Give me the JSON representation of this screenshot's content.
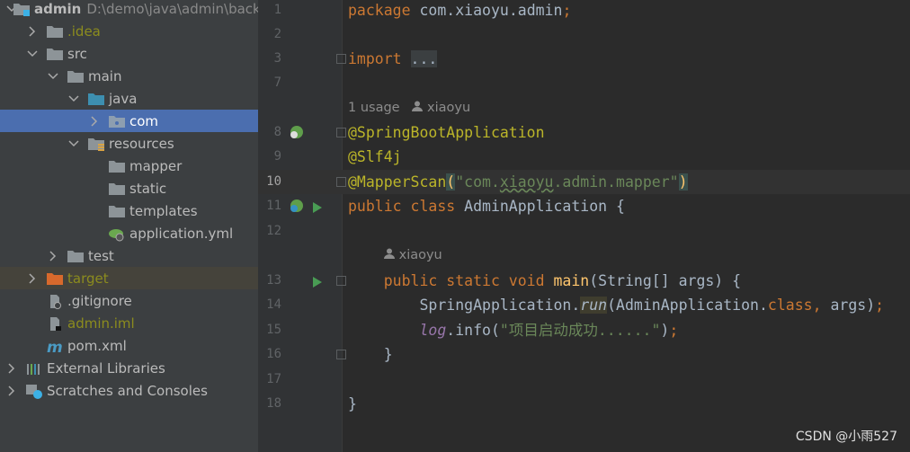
{
  "project_tree": [
    {
      "label": "admin",
      "extra": "D:\\demo\\java\\admin\\back",
      "depth": 0,
      "expanded": true,
      "icon": "module-folder-icon",
      "bold": true
    },
    {
      "label": ".idea",
      "depth": 1,
      "expanded": false,
      "icon": "folder-icon",
      "color": "olive"
    },
    {
      "label": "src",
      "depth": 1,
      "expanded": true,
      "icon": "folder-icon"
    },
    {
      "label": "main",
      "depth": 2,
      "expanded": true,
      "icon": "folder-icon"
    },
    {
      "label": "java",
      "depth": 3,
      "expanded": true,
      "icon": "source-folder-icon"
    },
    {
      "label": "com",
      "depth": 4,
      "expanded": false,
      "icon": "package-icon",
      "selected": true
    },
    {
      "label": "resources",
      "depth": 3,
      "expanded": true,
      "icon": "resources-folder-icon"
    },
    {
      "label": "mapper",
      "depth": 4,
      "icon": "folder-icon"
    },
    {
      "label": "static",
      "depth": 4,
      "icon": "folder-icon"
    },
    {
      "label": "templates",
      "depth": 4,
      "icon": "folder-icon"
    },
    {
      "label": "application.yml",
      "depth": 4,
      "icon": "spring-config-icon"
    },
    {
      "label": "test",
      "depth": 2,
      "expanded": false,
      "icon": "folder-icon"
    },
    {
      "label": "target",
      "depth": 1,
      "expanded": false,
      "icon": "excluded-folder-icon",
      "color": "olive",
      "excluded": true
    },
    {
      "label": ".gitignore",
      "depth": 1,
      "icon": "gitignore-file-icon"
    },
    {
      "label": "admin.iml",
      "depth": 1,
      "icon": "iml-file-icon",
      "color": "olive"
    },
    {
      "label": "pom.xml",
      "depth": 1,
      "icon": "maven-icon"
    },
    {
      "label": "External Libraries",
      "depth": 0,
      "expanded": false,
      "icon": "libraries-icon"
    },
    {
      "label": "Scratches and Consoles",
      "depth": 0,
      "expanded": false,
      "icon": "scratches-icon"
    }
  ],
  "colors": {
    "keyword": "#cc7832",
    "annotation": "#bbb529",
    "string": "#6a8759",
    "plain": "#a9b7c6",
    "method": "#ffc66d",
    "field": "#9876aa",
    "selection": "#4b6eaf"
  },
  "editor": {
    "current_line": "10",
    "lines": [
      {
        "n": "1",
        "tokens": [
          {
            "t": "package ",
            "c": "keyword"
          },
          {
            "t": "com.xiaoyu.admin",
            "c": "plain"
          },
          {
            "t": ";",
            "c": "keyword"
          }
        ]
      },
      {
        "n": "2",
        "tokens": []
      },
      {
        "n": "3",
        "fold": true,
        "tokens": [
          {
            "t": "import ",
            "c": "keyword"
          },
          {
            "t": "...",
            "c": "plain",
            "bg": "#3b3f41"
          }
        ]
      },
      {
        "n": "7",
        "tokens": []
      },
      {
        "hint": "1 usage",
        "author": "xiaoyu",
        "indent": 0
      },
      {
        "n": "8",
        "fold": true,
        "gutter": "spring-bean-icon",
        "tokens": [
          {
            "t": "@SpringBootApplication",
            "c": "annotation"
          }
        ]
      },
      {
        "n": "9",
        "tokens": [
          {
            "t": "@Slf4j",
            "c": "annotation"
          }
        ]
      },
      {
        "n": "10",
        "fold": true,
        "current": true,
        "tokens": [
          {
            "t": "@MapperScan",
            "c": "annotation"
          },
          {
            "t": "(",
            "c": "method",
            "bg": "#3b514d"
          },
          {
            "t": "\"com.",
            "c": "string"
          },
          {
            "t": "xiaoyu",
            "c": "string",
            "wavy": true
          },
          {
            "t": ".admin.mapper\"",
            "c": "string"
          },
          {
            "t": ")",
            "c": "method",
            "bg": "#3b514d"
          }
        ]
      },
      {
        "n": "11",
        "gutter": "spring-run-icon",
        "run": true,
        "tokens": [
          {
            "t": "public class ",
            "c": "keyword"
          },
          {
            "t": "AdminApplication {",
            "c": "plain"
          }
        ]
      },
      {
        "n": "12",
        "tokens": []
      },
      {
        "hint": "",
        "author": "xiaoyu",
        "indent": 4
      },
      {
        "n": "13",
        "run": true,
        "fold": true,
        "tokens": [
          {
            "t": "    public static void ",
            "c": "keyword"
          },
          {
            "t": "main",
            "c": "method"
          },
          {
            "t": "(String[] args) {",
            "c": "plain"
          }
        ]
      },
      {
        "n": "14",
        "tokens": [
          {
            "t": "        SpringApplication.",
            "c": "plain"
          },
          {
            "t": "run",
            "c": "plain",
            "italic": true,
            "bg": "#3f3d2e"
          },
          {
            "t": "(AdminApplication.",
            "c": "plain"
          },
          {
            "t": "class, ",
            "c": "keyword"
          },
          {
            "t": "args)",
            "c": "plain"
          },
          {
            "t": ";",
            "c": "keyword"
          }
        ]
      },
      {
        "n": "15",
        "tokens": [
          {
            "t": "        ",
            "c": "plain"
          },
          {
            "t": "log",
            "c": "field",
            "italic": true
          },
          {
            "t": ".info(",
            "c": "plain"
          },
          {
            "t": "\"项目启动成功......\"",
            "c": "string"
          },
          {
            "t": ")",
            "c": "plain"
          },
          {
            "t": ";",
            "c": "keyword"
          }
        ]
      },
      {
        "n": "16",
        "fold": true,
        "tokens": [
          {
            "t": "    }",
            "c": "plain"
          }
        ]
      },
      {
        "n": "17",
        "tokens": []
      },
      {
        "n": "18",
        "tokens": [
          {
            "t": "}",
            "c": "plain"
          }
        ]
      }
    ]
  },
  "watermark": "CSDN @小雨527"
}
